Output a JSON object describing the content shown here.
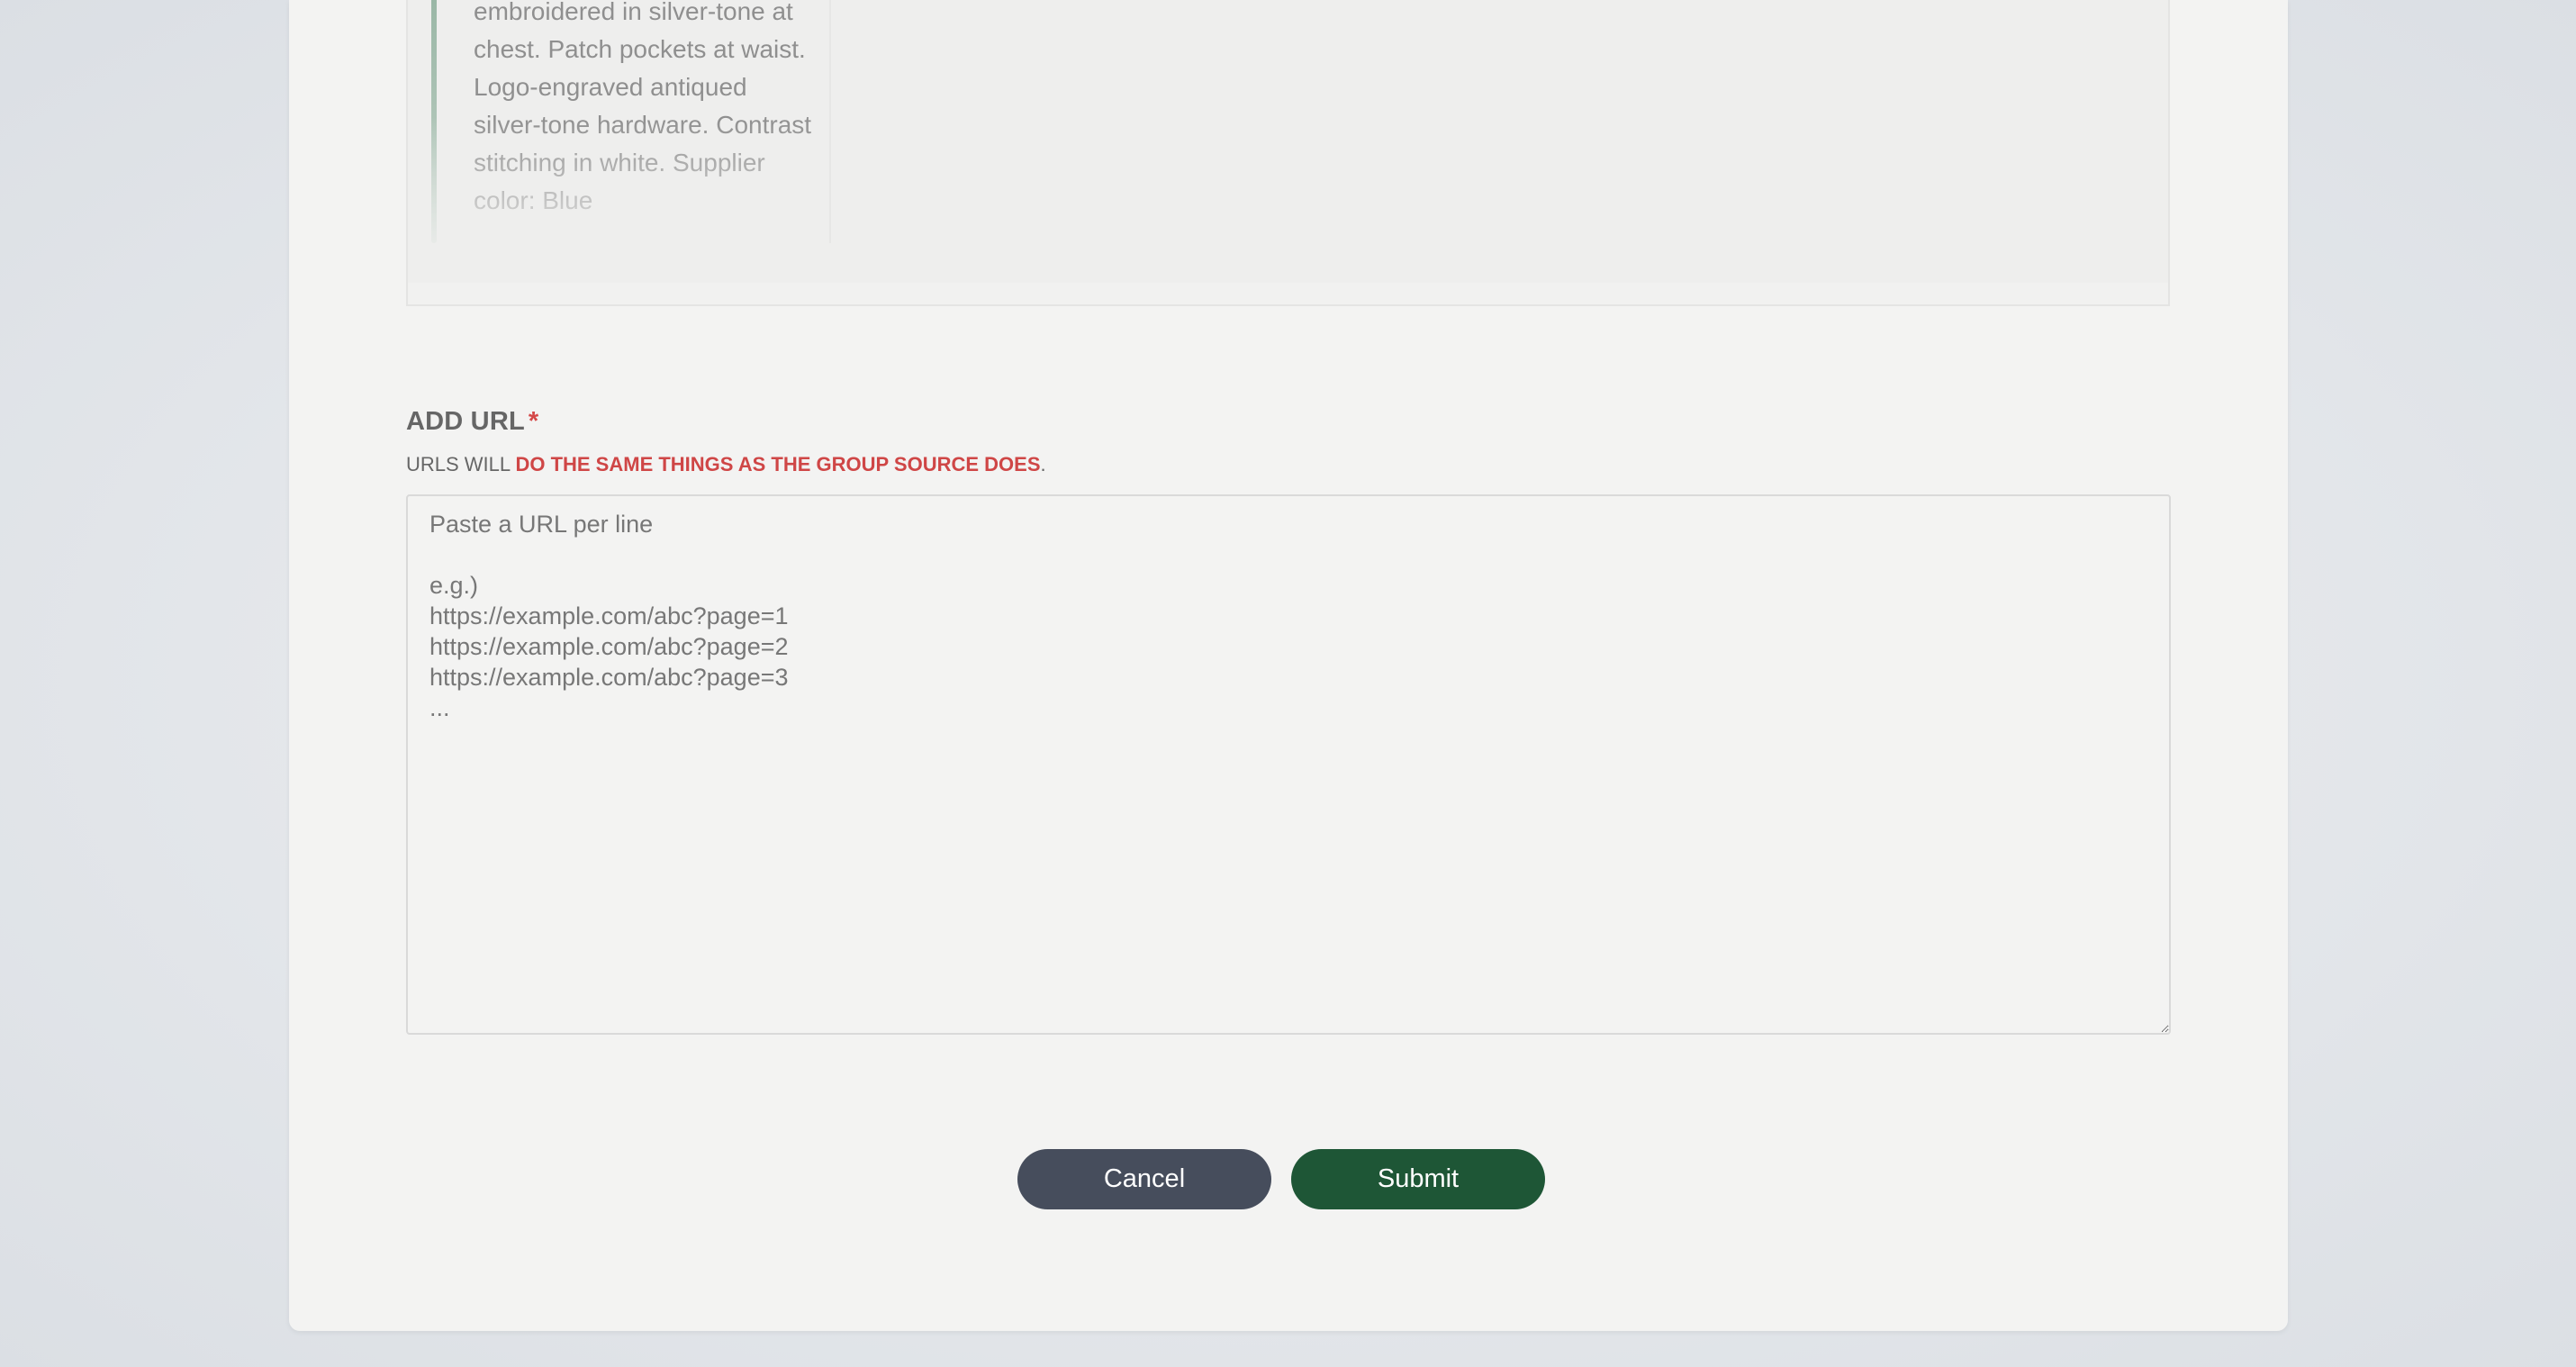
{
  "preview": {
    "description": "embroidered in silver-tone at chest. Patch pockets at waist. Logo-engraved antiqued silver-tone hardware. Contrast stitching in white. Supplier color: Blue"
  },
  "add_url": {
    "label": "ADD URL",
    "required_marker": "*",
    "hint_prefix": "URLS WILL ",
    "hint_emphasis": "DO THE SAME THINGS AS THE GROUP SOURCE DOES",
    "hint_suffix": ".",
    "placeholder": "Paste a URL per line\n\ne.g.)\nhttps://example.com/abc?page=1\nhttps://example.com/abc?page=2\nhttps://example.com/abc?page=3\n...",
    "value": ""
  },
  "actions": {
    "cancel_label": "Cancel",
    "submit_label": "Submit"
  },
  "colors": {
    "cancel_button": "#464d5c",
    "submit_button": "#1e5636",
    "required_accent": "#d44848"
  }
}
